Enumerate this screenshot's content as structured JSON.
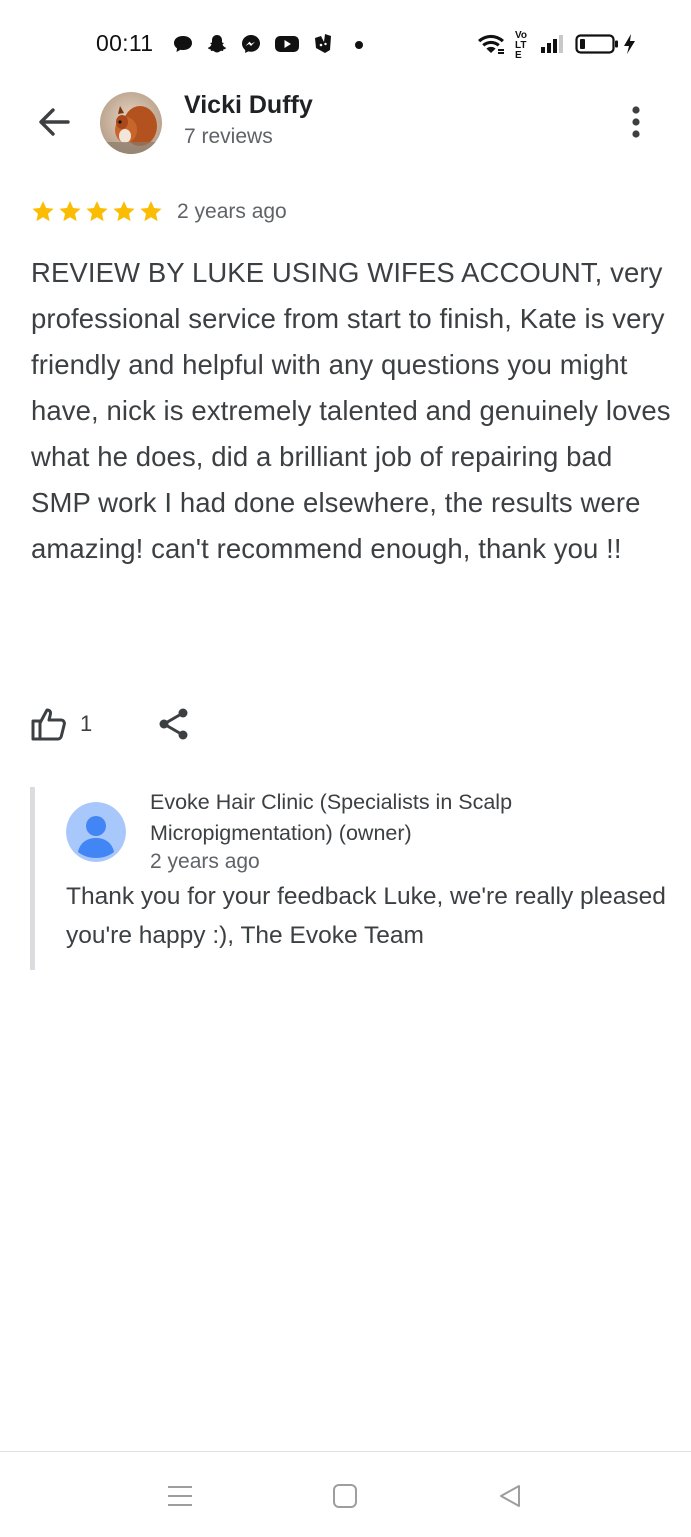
{
  "status_bar": {
    "time": "00:11",
    "left_icons": [
      "chat-bubble-icon",
      "snapchat-icon",
      "messenger-icon",
      "youtube-icon",
      "deliveroo-icon",
      "dot-icon"
    ],
    "right_icons": [
      "wifi-icon",
      "volte-icon",
      "signal-icon",
      "battery-icon",
      "charging-icon"
    ],
    "volte_label": "Vo LTE"
  },
  "header": {
    "reviewer_name": "Vicki Duffy",
    "reviewer_meta": "7 reviews",
    "back_icon": "arrow-left-icon",
    "more_icon": "more-vert-icon"
  },
  "review": {
    "rating": 5,
    "max_rating": 5,
    "star_color": "#fbbc04",
    "time": "2 years ago",
    "text": "REVIEW BY LUKE USING WIFES ACCOUNT, very professional service from start to finish, Kate is very friendly and helpful with any questions you might have, nick is extremely talented and genuinely loves what he does, did a brilliant job of repairing bad SMP work I had done elsewhere, the results were amazing! can't recommend enough, thank you !!",
    "like_count": "1"
  },
  "owner_reply": {
    "name": "Evoke Hair Clinic (Specialists in Scalp Micropigmentation) (owner)",
    "time": "2 years ago",
    "text": "Thank you for your feedback Luke, we're really pleased you're happy :), The Evoke Team",
    "avatar_color": "#a8c7fa",
    "avatar_figure_color": "#4285f4"
  },
  "nav_bar": {
    "icons": [
      "menu-icon",
      "home-square-icon",
      "back-triangle-icon"
    ]
  }
}
